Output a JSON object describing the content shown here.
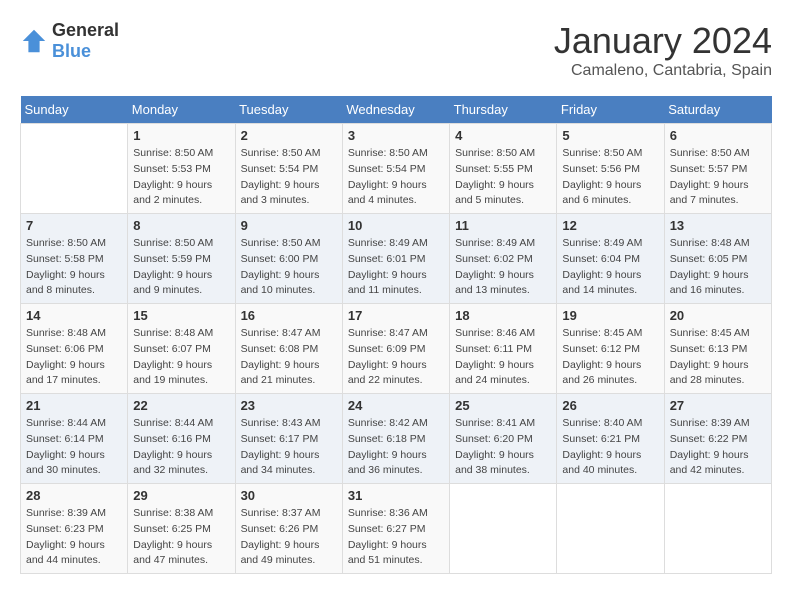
{
  "header": {
    "logo_general": "General",
    "logo_blue": "Blue",
    "month_year": "January 2024",
    "location": "Camaleno, Cantabria, Spain"
  },
  "weekdays": [
    "Sunday",
    "Monday",
    "Tuesday",
    "Wednesday",
    "Thursday",
    "Friday",
    "Saturday"
  ],
  "weeks": [
    [
      {
        "day": "",
        "sunrise": "",
        "sunset": "",
        "daylight": ""
      },
      {
        "day": "1",
        "sunrise": "Sunrise: 8:50 AM",
        "sunset": "Sunset: 5:53 PM",
        "daylight": "Daylight: 9 hours and 2 minutes."
      },
      {
        "day": "2",
        "sunrise": "Sunrise: 8:50 AM",
        "sunset": "Sunset: 5:54 PM",
        "daylight": "Daylight: 9 hours and 3 minutes."
      },
      {
        "day": "3",
        "sunrise": "Sunrise: 8:50 AM",
        "sunset": "Sunset: 5:54 PM",
        "daylight": "Daylight: 9 hours and 4 minutes."
      },
      {
        "day": "4",
        "sunrise": "Sunrise: 8:50 AM",
        "sunset": "Sunset: 5:55 PM",
        "daylight": "Daylight: 9 hours and 5 minutes."
      },
      {
        "day": "5",
        "sunrise": "Sunrise: 8:50 AM",
        "sunset": "Sunset: 5:56 PM",
        "daylight": "Daylight: 9 hours and 6 minutes."
      },
      {
        "day": "6",
        "sunrise": "Sunrise: 8:50 AM",
        "sunset": "Sunset: 5:57 PM",
        "daylight": "Daylight: 9 hours and 7 minutes."
      }
    ],
    [
      {
        "day": "7",
        "sunrise": "Sunrise: 8:50 AM",
        "sunset": "Sunset: 5:58 PM",
        "daylight": "Daylight: 9 hours and 8 minutes."
      },
      {
        "day": "8",
        "sunrise": "Sunrise: 8:50 AM",
        "sunset": "Sunset: 5:59 PM",
        "daylight": "Daylight: 9 hours and 9 minutes."
      },
      {
        "day": "9",
        "sunrise": "Sunrise: 8:50 AM",
        "sunset": "Sunset: 6:00 PM",
        "daylight": "Daylight: 9 hours and 10 minutes."
      },
      {
        "day": "10",
        "sunrise": "Sunrise: 8:49 AM",
        "sunset": "Sunset: 6:01 PM",
        "daylight": "Daylight: 9 hours and 11 minutes."
      },
      {
        "day": "11",
        "sunrise": "Sunrise: 8:49 AM",
        "sunset": "Sunset: 6:02 PM",
        "daylight": "Daylight: 9 hours and 13 minutes."
      },
      {
        "day": "12",
        "sunrise": "Sunrise: 8:49 AM",
        "sunset": "Sunset: 6:04 PM",
        "daylight": "Daylight: 9 hours and 14 minutes."
      },
      {
        "day": "13",
        "sunrise": "Sunrise: 8:48 AM",
        "sunset": "Sunset: 6:05 PM",
        "daylight": "Daylight: 9 hours and 16 minutes."
      }
    ],
    [
      {
        "day": "14",
        "sunrise": "Sunrise: 8:48 AM",
        "sunset": "Sunset: 6:06 PM",
        "daylight": "Daylight: 9 hours and 17 minutes."
      },
      {
        "day": "15",
        "sunrise": "Sunrise: 8:48 AM",
        "sunset": "Sunset: 6:07 PM",
        "daylight": "Daylight: 9 hours and 19 minutes."
      },
      {
        "day": "16",
        "sunrise": "Sunrise: 8:47 AM",
        "sunset": "Sunset: 6:08 PM",
        "daylight": "Daylight: 9 hours and 21 minutes."
      },
      {
        "day": "17",
        "sunrise": "Sunrise: 8:47 AM",
        "sunset": "Sunset: 6:09 PM",
        "daylight": "Daylight: 9 hours and 22 minutes."
      },
      {
        "day": "18",
        "sunrise": "Sunrise: 8:46 AM",
        "sunset": "Sunset: 6:11 PM",
        "daylight": "Daylight: 9 hours and 24 minutes."
      },
      {
        "day": "19",
        "sunrise": "Sunrise: 8:45 AM",
        "sunset": "Sunset: 6:12 PM",
        "daylight": "Daylight: 9 hours and 26 minutes."
      },
      {
        "day": "20",
        "sunrise": "Sunrise: 8:45 AM",
        "sunset": "Sunset: 6:13 PM",
        "daylight": "Daylight: 9 hours and 28 minutes."
      }
    ],
    [
      {
        "day": "21",
        "sunrise": "Sunrise: 8:44 AM",
        "sunset": "Sunset: 6:14 PM",
        "daylight": "Daylight: 9 hours and 30 minutes."
      },
      {
        "day": "22",
        "sunrise": "Sunrise: 8:44 AM",
        "sunset": "Sunset: 6:16 PM",
        "daylight": "Daylight: 9 hours and 32 minutes."
      },
      {
        "day": "23",
        "sunrise": "Sunrise: 8:43 AM",
        "sunset": "Sunset: 6:17 PM",
        "daylight": "Daylight: 9 hours and 34 minutes."
      },
      {
        "day": "24",
        "sunrise": "Sunrise: 8:42 AM",
        "sunset": "Sunset: 6:18 PM",
        "daylight": "Daylight: 9 hours and 36 minutes."
      },
      {
        "day": "25",
        "sunrise": "Sunrise: 8:41 AM",
        "sunset": "Sunset: 6:20 PM",
        "daylight": "Daylight: 9 hours and 38 minutes."
      },
      {
        "day": "26",
        "sunrise": "Sunrise: 8:40 AM",
        "sunset": "Sunset: 6:21 PM",
        "daylight": "Daylight: 9 hours and 40 minutes."
      },
      {
        "day": "27",
        "sunrise": "Sunrise: 8:39 AM",
        "sunset": "Sunset: 6:22 PM",
        "daylight": "Daylight: 9 hours and 42 minutes."
      }
    ],
    [
      {
        "day": "28",
        "sunrise": "Sunrise: 8:39 AM",
        "sunset": "Sunset: 6:23 PM",
        "daylight": "Daylight: 9 hours and 44 minutes."
      },
      {
        "day": "29",
        "sunrise": "Sunrise: 8:38 AM",
        "sunset": "Sunset: 6:25 PM",
        "daylight": "Daylight: 9 hours and 47 minutes."
      },
      {
        "day": "30",
        "sunrise": "Sunrise: 8:37 AM",
        "sunset": "Sunset: 6:26 PM",
        "daylight": "Daylight: 9 hours and 49 minutes."
      },
      {
        "day": "31",
        "sunrise": "Sunrise: 8:36 AM",
        "sunset": "Sunset: 6:27 PM",
        "daylight": "Daylight: 9 hours and 51 minutes."
      },
      {
        "day": "",
        "sunrise": "",
        "sunset": "",
        "daylight": ""
      },
      {
        "day": "",
        "sunrise": "",
        "sunset": "",
        "daylight": ""
      },
      {
        "day": "",
        "sunrise": "",
        "sunset": "",
        "daylight": ""
      }
    ]
  ]
}
